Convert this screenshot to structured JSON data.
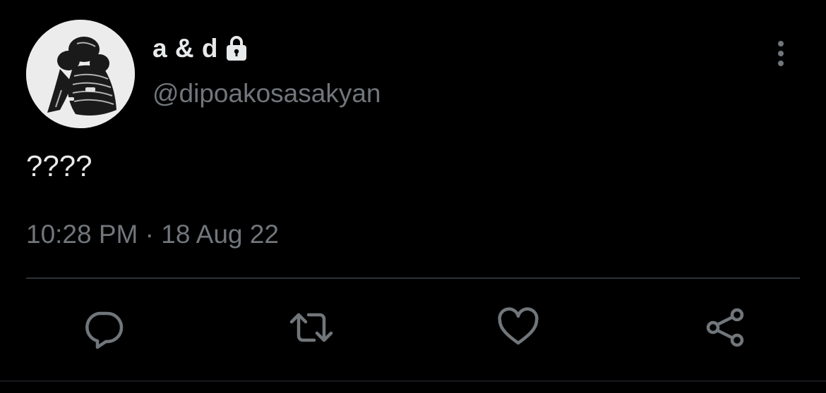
{
  "author": {
    "display_name": "a & d",
    "handle": "@dipoakosasakyan",
    "protected": true,
    "avatar": "profile-photo"
  },
  "tweet": {
    "text": "????",
    "timestamp": "10:28 PM · 18 Aug 22"
  },
  "icons": {
    "lock": "lock-icon",
    "more": "more-vertical-icon",
    "reply": "reply-icon",
    "retweet": "retweet-icon",
    "like": "heart-icon",
    "share": "share-icon"
  },
  "colors": {
    "background": "#000000",
    "primary_text": "#e7e9ea",
    "secondary_text": "#71767b",
    "divider": "#2f3336"
  }
}
